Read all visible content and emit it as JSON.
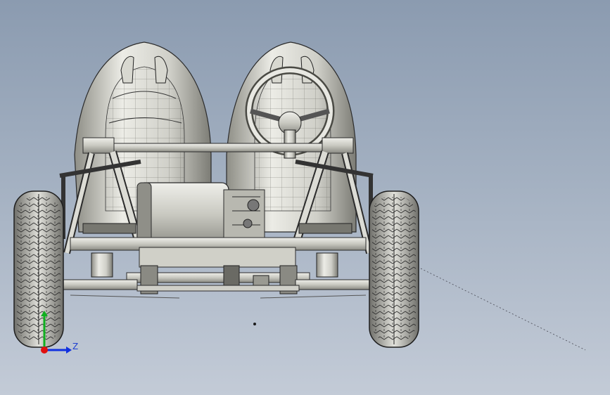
{
  "viewport": {
    "view_name": "front-view",
    "colors": {
      "background_top": "#8b9bb0",
      "background_bottom": "#c3cbd7",
      "part_fill": "#d9d9d2",
      "part_shade": "#9a9a92",
      "edge": "#2b2b2b"
    }
  },
  "triad": {
    "z_label": "Z",
    "colors": {
      "x": "#e01010",
      "y": "#10b020",
      "z": "#1030e0"
    }
  }
}
